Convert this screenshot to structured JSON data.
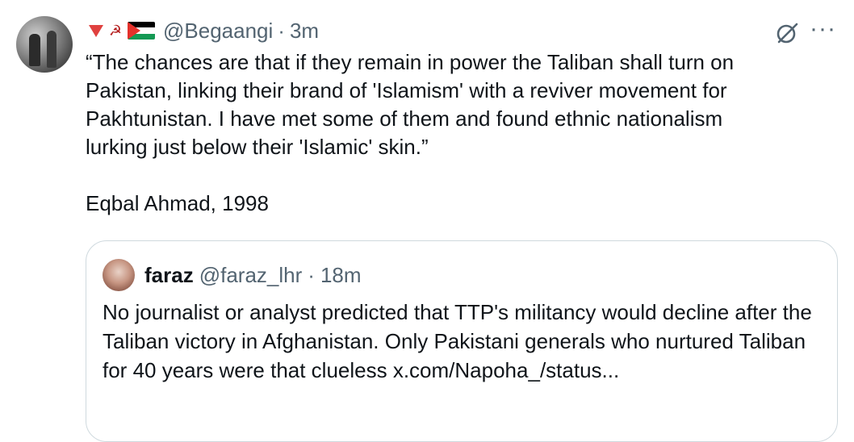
{
  "tweet": {
    "handle": "@Begaangi",
    "separator": "·",
    "time": "3m",
    "emoji_icons": [
      "red-triangle-down-icon",
      "hammer-and-sickle-icon",
      "palestine-flag-icon"
    ],
    "body": "“The chances are that if they remain in power the Taliban shall turn on\nPakistan, linking their brand of 'Islamism' with a reviver movement for\nPakhtunistan. I have met some of them and found ethnic nationalism\nlurking just below their 'Islamic' skin.”\n\nEqbal Ahmad, 1998",
    "more_label": "···"
  },
  "quote": {
    "name": "faraz",
    "handle": "@faraz_lhr",
    "separator": "·",
    "time": "18m",
    "text": "No journalist or analyst predicted that TTP's militancy would decline after the Taliban victory in Afghanistan. Only Pakistani generals who nurtured Taliban for 40 years were that clueless x.com/Napoha_/status..."
  },
  "colors": {
    "text_primary": "#0f1419",
    "text_secondary": "#536471",
    "border": "#cfd9de"
  }
}
